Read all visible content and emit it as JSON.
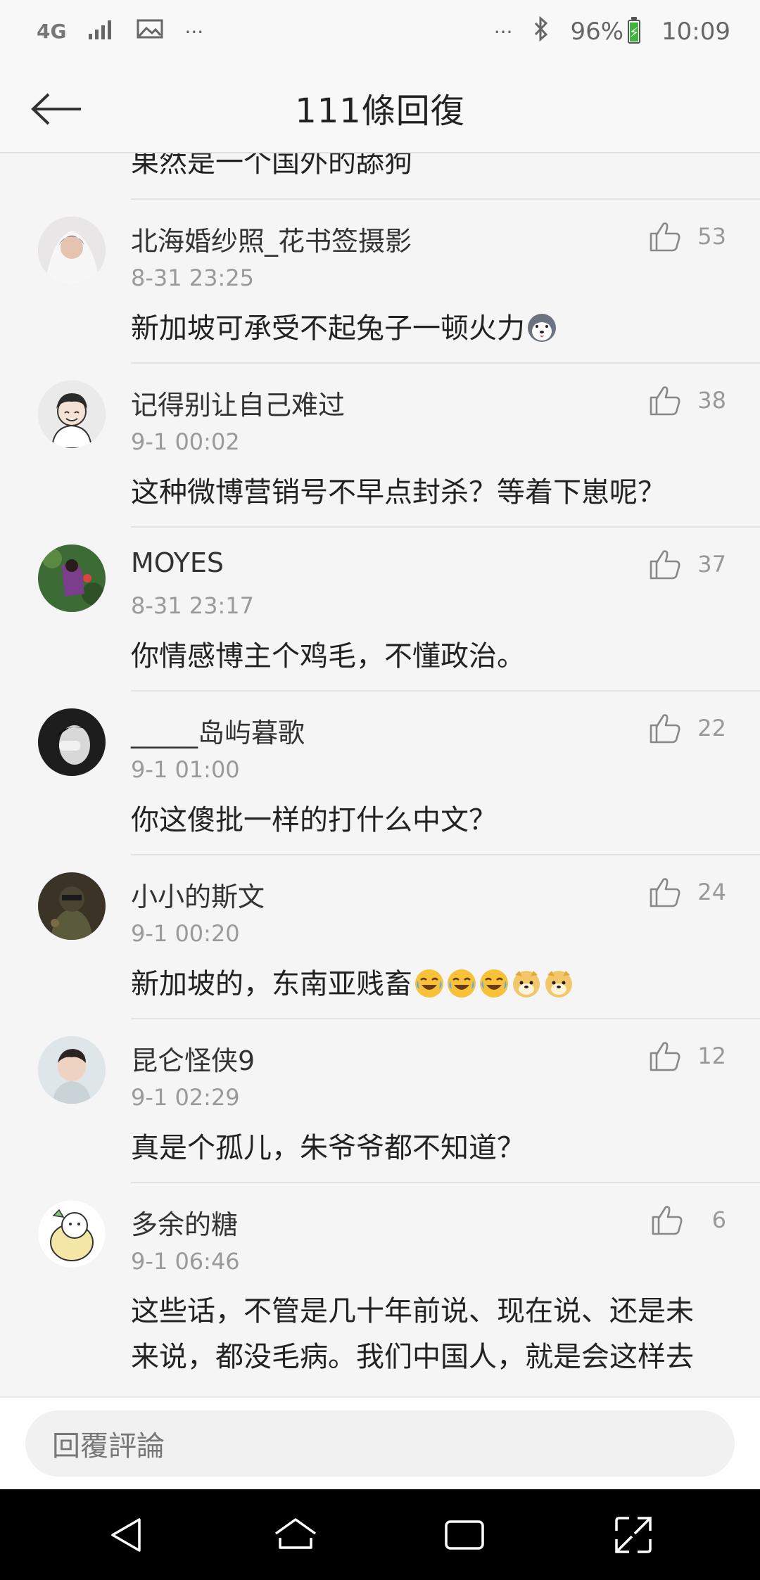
{
  "status_bar": {
    "network": "4G",
    "dots_left": "···",
    "dots_right": "···",
    "battery": "96%",
    "time": "10:09"
  },
  "header": {
    "title": "111條回復"
  },
  "partial_comment": {
    "text": "果然是一个国外的舔狗"
  },
  "comments": [
    {
      "name": "北海婚纱照_花书签摄影",
      "time": "8-31 23:25",
      "text": "新加坡可承受不起兔子一顿火力",
      "likes": "53",
      "emojis": [
        "husky-face-emoji"
      ]
    },
    {
      "name": "记得别让自己难过",
      "time": "9-1 00:02",
      "text": "这种微博营销号不早点封杀？等着下崽呢？",
      "likes": "38",
      "emojis": []
    },
    {
      "name": "MOYES",
      "time": "8-31 23:17",
      "text": "你情感博主个鸡毛，不懂政治。",
      "likes": "37",
      "emojis": []
    },
    {
      "name": "_____岛屿暮歌",
      "time": "9-1 01:00",
      "text": "你这傻批一样的打什么中文？",
      "likes": "22",
      "emojis": []
    },
    {
      "name": "小小的斯文",
      "time": "9-1 00:20",
      "text": "新加坡的，东南亚贱畜",
      "likes": "24",
      "emojis": [
        "laugh-cry-emoji",
        "laugh-cry-emoji",
        "laugh-cry-emoji",
        "doge-emoji",
        "doge-emoji"
      ]
    },
    {
      "name": "昆仑怪侠9",
      "time": "9-1 02:29",
      "text": "真是个孤儿，朱爷爷都不知道？",
      "likes": "12",
      "emojis": []
    },
    {
      "name": "多余的糖",
      "time": "9-1 06:46",
      "text_lines": [
        "这些话，不管是几十年前说、现在说、还是未",
        "来说，都没毛病。我们中国人，就是会这样去"
      ],
      "likes": "6",
      "emojis": []
    }
  ],
  "reply": {
    "placeholder": "回覆評論"
  },
  "colors": {
    "background": "#f5f5f5",
    "header_bg": "#f8f8f8",
    "time_gray": "#9a9a9a",
    "nav_bg": "#000000"
  }
}
